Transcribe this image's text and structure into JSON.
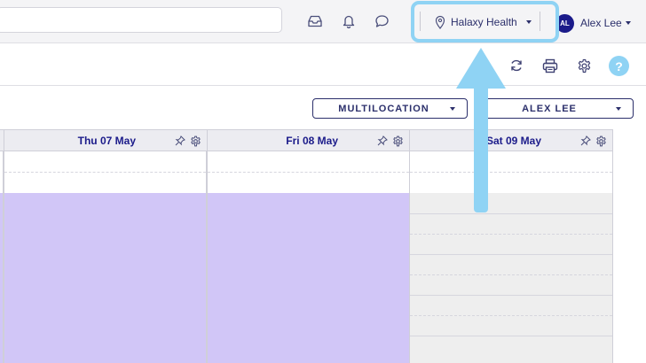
{
  "topbar": {
    "location": {
      "label": "Halaxy Health",
      "icon": "map-pin-icon"
    },
    "user": {
      "initials": "AL",
      "name": "Alex Lee"
    },
    "icons": [
      "inbox-icon",
      "bell-icon",
      "chat-icon"
    ]
  },
  "toolbar": {
    "icons": [
      "refresh-icon",
      "print-icon",
      "settings-icon"
    ],
    "help_label": "?"
  },
  "filters": {
    "location_dropdown": "MULTILOCATION",
    "practitioner_dropdown": "ALEX LEE"
  },
  "calendar": {
    "days": [
      {
        "label": "Thu 07 May"
      },
      {
        "label": "Fri 08 May"
      },
      {
        "label": "Sat 09 May"
      }
    ]
  },
  "colors": {
    "accent": "#8fd3f4",
    "navy": "#1b1b8a",
    "available": "#d1c6f7",
    "unavailable": "#eeeeee"
  }
}
